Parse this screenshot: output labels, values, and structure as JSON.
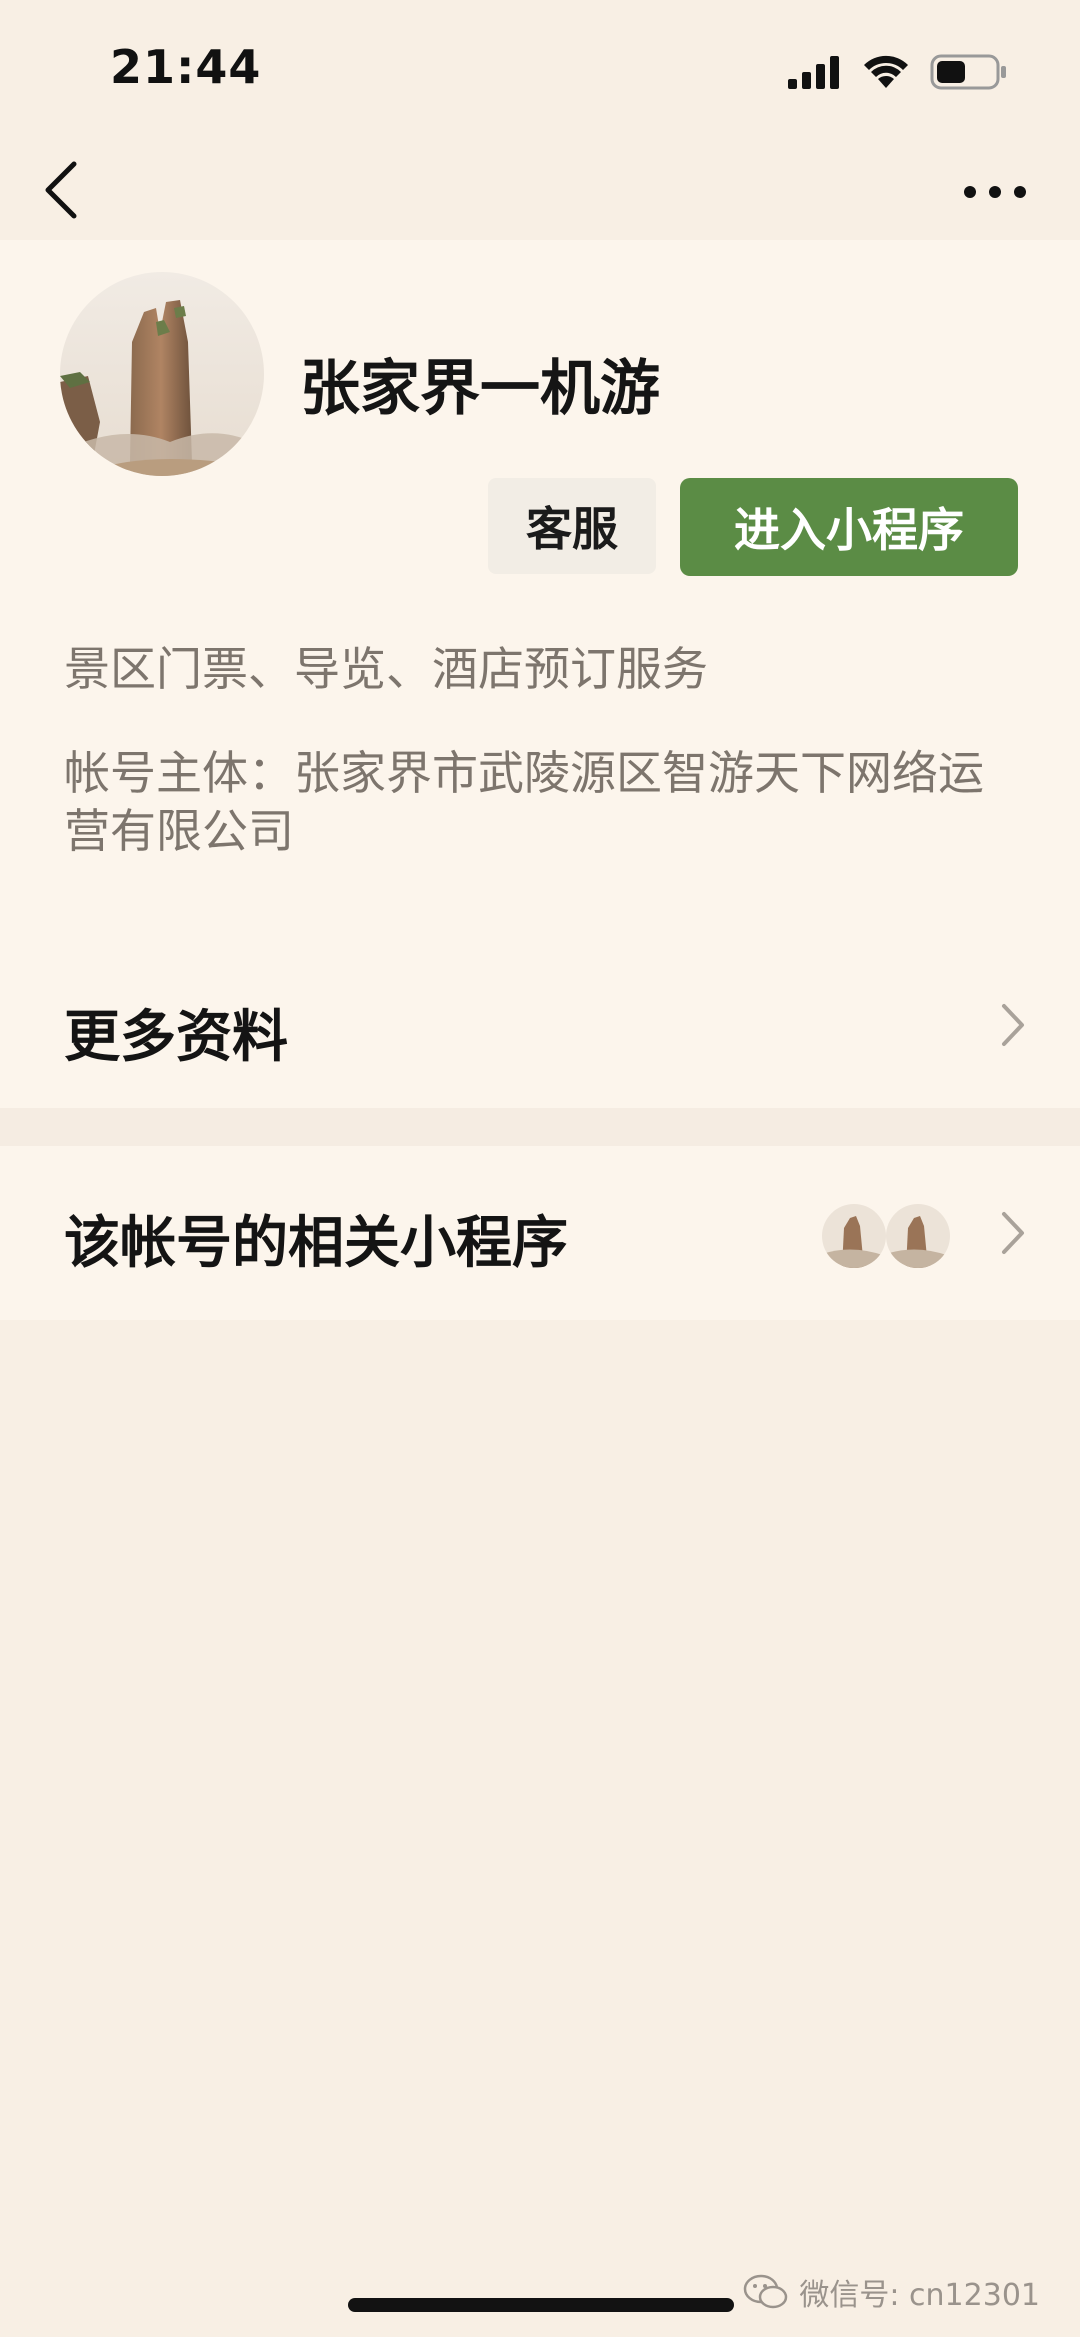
{
  "status_bar": {
    "time": "21:44"
  },
  "nav": {
    "back_icon": "chevron-left-icon",
    "more_icon": "more-dots-icon"
  },
  "profile": {
    "name": "张家界一机游",
    "service_button": "客服",
    "enter_button": "进入小程序",
    "description": "景区门票、导览、酒店预订服务",
    "owner": "帐号主体：张家界市武陵源区智游天下网络运营有限公司",
    "accent_color": "#5b8c45"
  },
  "rows": [
    {
      "label": "更多资料"
    },
    {
      "label": "该帐号的相关小程序"
    }
  ],
  "watermark": {
    "text": "微信号: cn12301"
  }
}
